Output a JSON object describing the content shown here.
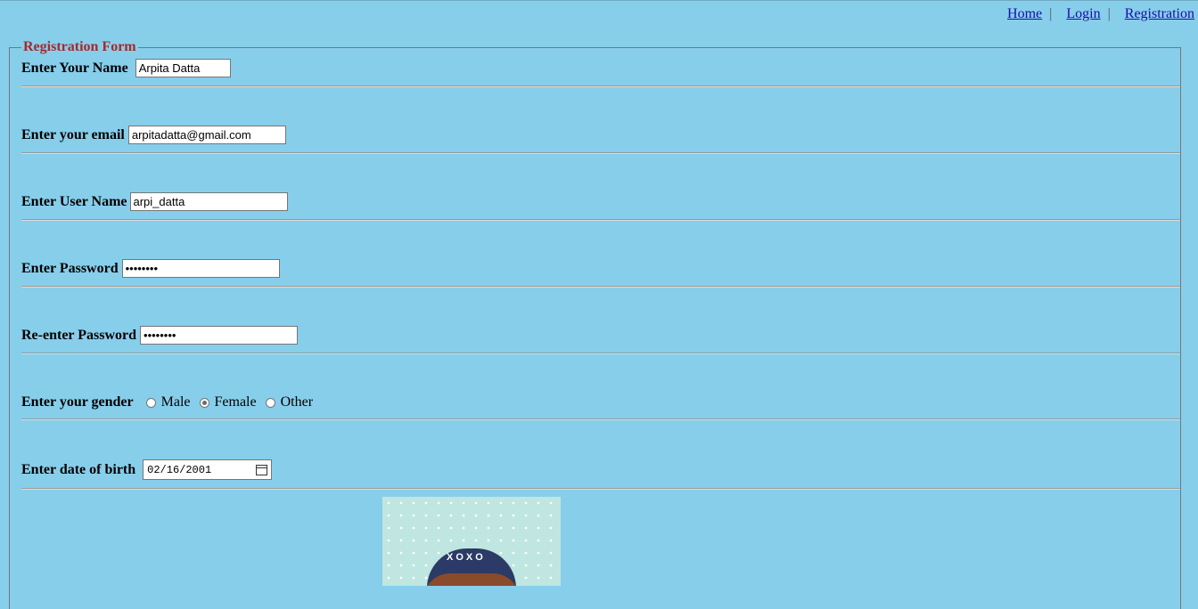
{
  "nav": {
    "home": "Home",
    "login": "Login",
    "registration": "Registration",
    "separator": "|"
  },
  "form": {
    "legend": "Registration Form",
    "name_label": "Enter Your Name",
    "name_value": "Arpita Datta",
    "email_label": "Enter your email",
    "email_value": "arpitadatta@gmail.com",
    "username_label": "Enter User Name",
    "username_value": "arpi_datta",
    "password_label": "Enter Password",
    "password_value": "••••••••",
    "repassword_label": "Re-enter Password",
    "repassword_value": "••••••••",
    "gender_label": "Enter your gender",
    "gender_options": [
      "Male",
      "Female",
      "Other"
    ],
    "gender_selected": "Female",
    "dob_label": "Enter date of birth",
    "dob_value": "02/16/2001"
  },
  "avatar": {
    "cap_text": "XOXO"
  }
}
